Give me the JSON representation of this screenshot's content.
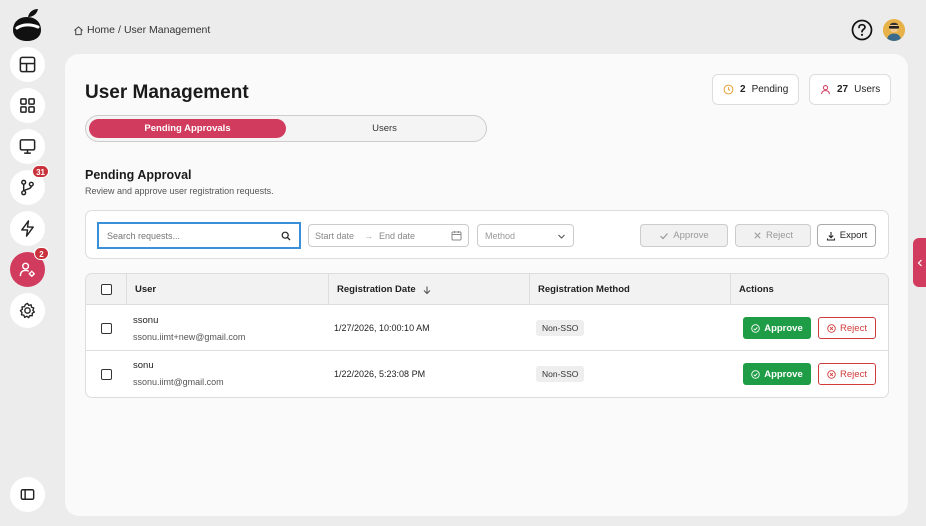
{
  "breadcrumb": {
    "home": "Home",
    "separator": "/",
    "current": "User Management"
  },
  "sidebar": {
    "items": [
      {
        "name": "dashboard-icon"
      },
      {
        "name": "grid-icon"
      },
      {
        "name": "monitor-icon"
      },
      {
        "name": "branch-icon",
        "badge": "31"
      },
      {
        "name": "lightning-icon"
      },
      {
        "name": "user-settings-icon",
        "badge": "2",
        "active": true
      },
      {
        "name": "gear-icon"
      }
    ],
    "collapse_icon": "sidebar-toggle-icon"
  },
  "header": {
    "help_icon": "help-icon",
    "avatar": "avatar"
  },
  "page": {
    "title": "User Management",
    "stats": [
      {
        "count": "2",
        "label": "Pending",
        "icon": "clock-icon",
        "color": "#e8a13a"
      },
      {
        "count": "27",
        "label": "Users",
        "icon": "user-icon",
        "color": "#d13b5d"
      }
    ],
    "tabs": [
      {
        "label": "Pending Approvals",
        "active": true
      },
      {
        "label": "Users",
        "active": false
      }
    ],
    "section": {
      "title": "Pending Approval",
      "subtitle": "Review and approve user registration requests."
    },
    "filters": {
      "search_placeholder": "Search requests...",
      "start_date": "Start date",
      "end_date": "End date",
      "method_placeholder": "Method",
      "approve_label": "Approve",
      "reject_label": "Reject",
      "export_label": "Export"
    },
    "table": {
      "headers": {
        "user": "User",
        "date": "Registration Date",
        "method": "Registration Method",
        "actions": "Actions"
      },
      "rows": [
        {
          "name": "ssonu",
          "email": "ssonu.iimt+new@gmail.com",
          "date": "1/27/2026, 10:00:10 AM",
          "method": "Non-SSO",
          "approve": "Approve",
          "reject": "Reject"
        },
        {
          "name": "sonu",
          "email": "ssonu.iimt@gmail.com",
          "date": "1/22/2026, 5:23:08 PM",
          "method": "Non-SSO",
          "approve": "Approve",
          "reject": "Reject"
        }
      ]
    }
  },
  "colors": {
    "accent": "#d13b5d",
    "approve": "#1f9d46",
    "reject": "#d13b3b",
    "focus": "#3a8fd9"
  }
}
